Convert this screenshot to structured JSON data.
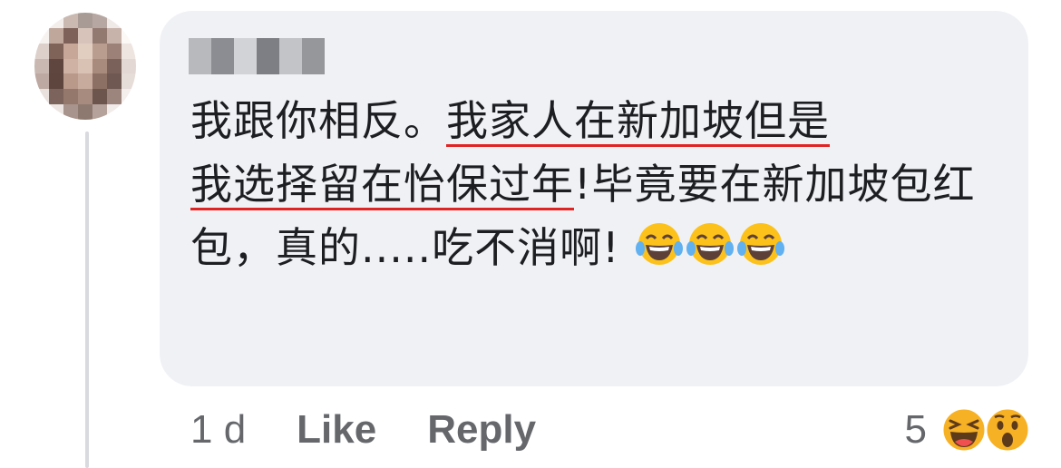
{
  "comment": {
    "author_name": "",
    "text_before": "我跟你相反。",
    "text_underlined_1": "我家人在新加坡但是",
    "text_underlined_2": "我选择留在怡保过年",
    "text_after": "!毕竟要在新加坡包红包，真的.....吃不消啊!",
    "emoji_icons": [
      "laughing-tears-icon",
      "laughing-tears-icon",
      "laughing-tears-icon"
    ],
    "underline_color": "#e02424"
  },
  "actions": {
    "timestamp": "1 d",
    "like_label": "Like",
    "reply_label": "Reply"
  },
  "reactions": {
    "count": "5",
    "icons": [
      "haha-reaction-icon",
      "wow-reaction-icon"
    ]
  },
  "colors": {
    "bubble_background": "#f0f1f5",
    "text": "#1c1e21",
    "secondary_text": "#65676b",
    "thread_line": "#d8dadf"
  }
}
